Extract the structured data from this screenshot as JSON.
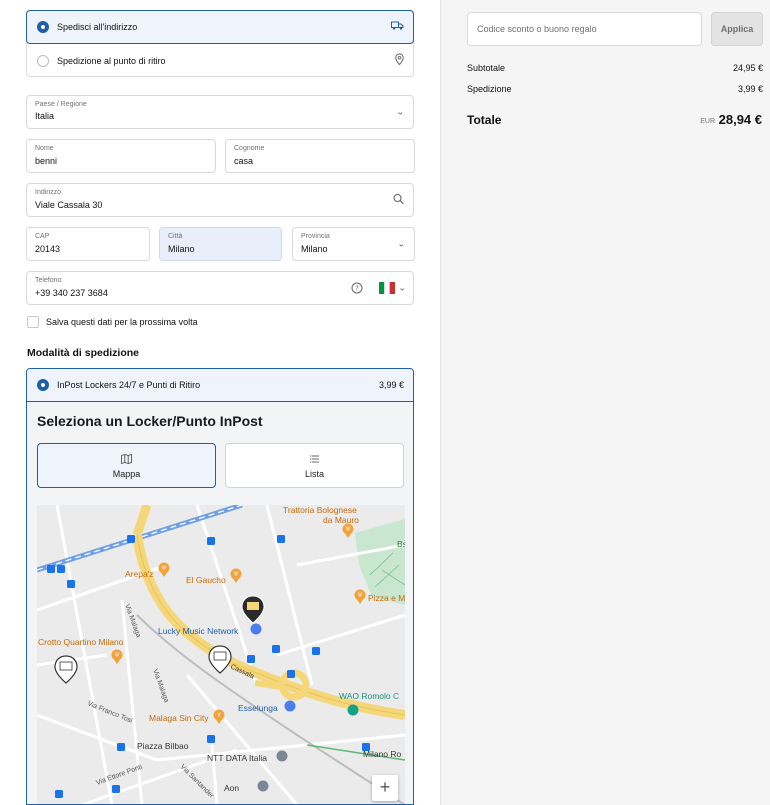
{
  "delivery": {
    "options": [
      {
        "label": "Spedisci all'indirizzo",
        "selected": true,
        "icon": "truck-icon"
      },
      {
        "label": "Spedizione al punto di ritiro",
        "selected": false,
        "icon": "location-pin-icon"
      }
    ]
  },
  "form": {
    "country": {
      "label": "Paese / Regione",
      "value": "Italia"
    },
    "first_name": {
      "label": "Nome",
      "value": "benni"
    },
    "last_name": {
      "label": "Cognome",
      "value": "casa"
    },
    "address": {
      "label": "Indirizzo",
      "value": "Viale Cassala 30"
    },
    "zip": {
      "label": "CAP",
      "value": "20143"
    },
    "city": {
      "label": "Città",
      "value": "Milano"
    },
    "province": {
      "label": "Provincia",
      "value": "Milano"
    },
    "phone": {
      "label": "Telefono",
      "value": "+39 340 237 3684"
    },
    "save_label": "Salva questi dati per la prossima volta"
  },
  "shipping": {
    "title": "Modalità di spedizione",
    "method_name": "InPost Lockers 24/7 e Punti di Ritiro",
    "method_price": "3,99 €",
    "locker_title": "Seleziona un Locker/Punto InPost",
    "tabs": [
      {
        "label": "Mappa",
        "active": true
      },
      {
        "label": "Lista",
        "active": false
      }
    ]
  },
  "map": {
    "labels": {
      "trattoria": "Trattoria Bolognese",
      "trattoria2": "da Mauro",
      "arepa": "Arepa'z",
      "gaucho": "El Gaucho",
      "pizza": "Pizza e M",
      "lucky": "Lucky Music Network",
      "crotto": "Crotto Quartino Milano",
      "cassala": "Cassala",
      "wao": "WAO Romolo C",
      "esselunga": "Esselunga",
      "malaga": "Via Malaga",
      "malaga2": "Via Malaga",
      "malaga_sin": "Malaga Sin City",
      "franco": "Via Franco Tosi",
      "bilbao": "Piazza Bilbao",
      "ntt": "NTT DATA Italia",
      "ettore": "Via Ettore Ponti",
      "santander": "Via Santander",
      "milano_ro": "Milano Ro",
      "aon": "Aon",
      "bs": "Bs"
    },
    "zoom_in": "+"
  },
  "summary": {
    "discount_placeholder": "Codice sconto o buono regalo",
    "apply_label": "Applica",
    "subtotal_label": "Subtotale",
    "subtotal_value": "24,95 €",
    "shipping_label": "Spedizione",
    "shipping_value": "3,99 €",
    "total_label": "Totale",
    "currency": "EUR",
    "total_value": "28,94 €"
  },
  "colors": {
    "accent": "#1f5ea8",
    "selected_bg": "#eef3fc",
    "map_road_major": "#f5d77a",
    "map_poi_orange": "#f2a23a",
    "map_transit_blue": "#1a73e8"
  }
}
